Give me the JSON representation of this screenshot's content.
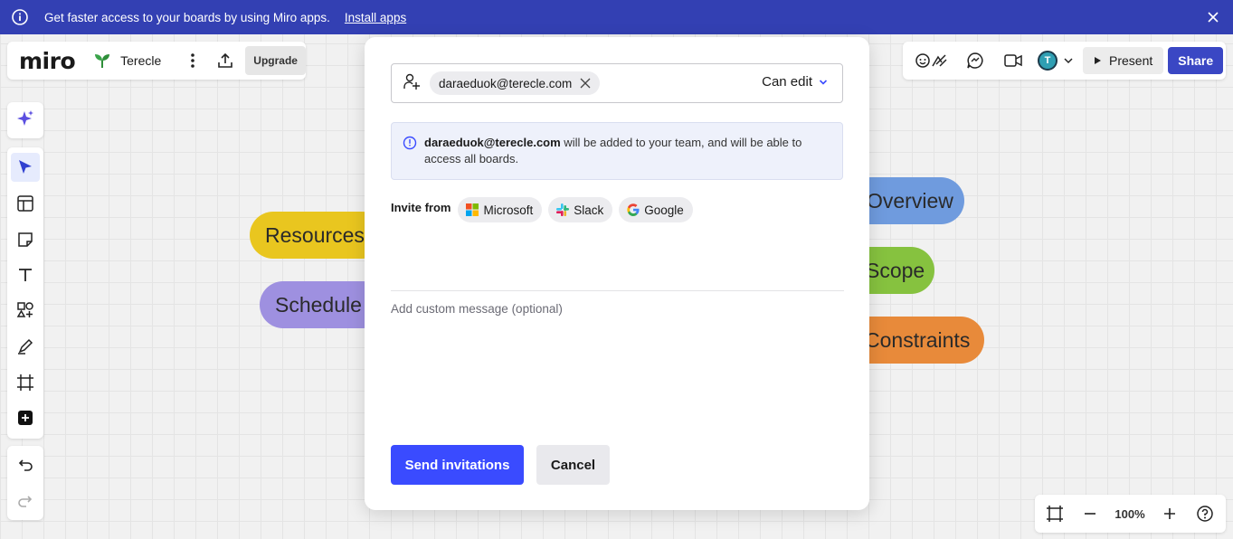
{
  "banner": {
    "message": "Get faster access to your boards by using Miro apps.",
    "install_link": "Install apps"
  },
  "board_bar": {
    "logo": "miro",
    "board_name": "Terecle",
    "upgrade_label": "Upgrade"
  },
  "right_bar": {
    "avatar_initial": "T",
    "present_label": "Present",
    "share_label": "Share"
  },
  "stickers": {
    "resources": {
      "label": "Resources",
      "color": "#e9c61f"
    },
    "schedule": {
      "label": "Schedule",
      "color": "#9e90e0"
    },
    "overview": {
      "label": "Overview",
      "color": "#6f9bde"
    },
    "scope": {
      "label": "Scope",
      "color": "#86c23f"
    },
    "constraints": {
      "label": "Constraints",
      "color": "#e88a3a"
    }
  },
  "zoom": {
    "level": "100%"
  },
  "modal": {
    "invitee_email": "daraeduok@terecle.com",
    "permission": "Can edit",
    "notice": {
      "email": "daraeduok@terecle.com",
      "text": " will be added to your team, and will be able to access all boards."
    },
    "invite_from_label": "Invite from",
    "providers": [
      "Microsoft",
      "Slack",
      "Google"
    ],
    "message_placeholder": "Add custom message (optional)",
    "send_label": "Send invitations",
    "cancel_label": "Cancel"
  },
  "colors": {
    "banner_bg": "#3340b3",
    "primary": "#3a4bff",
    "share_bg": "#3a47c4"
  }
}
